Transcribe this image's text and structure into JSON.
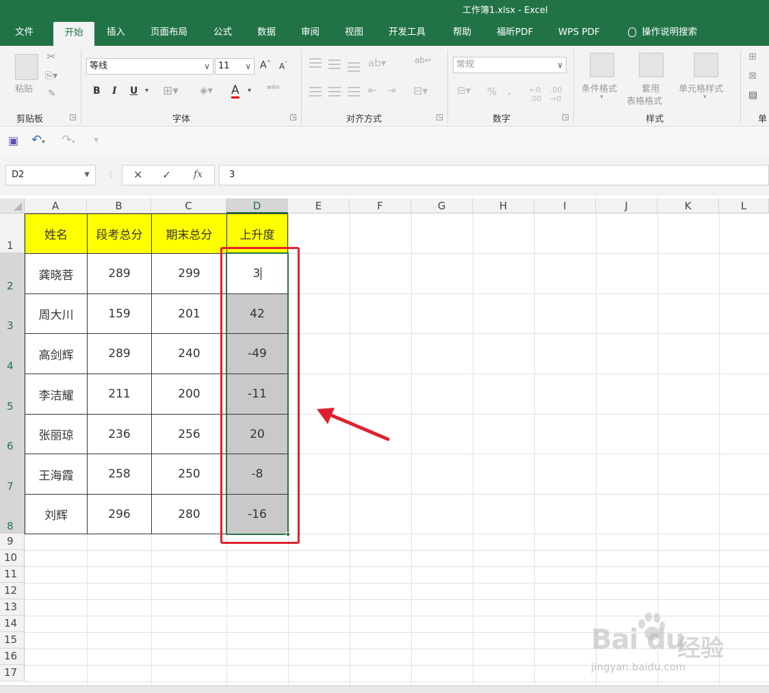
{
  "window": {
    "title": "工作簿1.xlsx  -  Excel"
  },
  "ribbon_tabs": [
    {
      "label": "文件",
      "active": false
    },
    {
      "label": "开始",
      "active": true
    },
    {
      "label": "插入",
      "active": false
    },
    {
      "label": "页面布局",
      "active": false
    },
    {
      "label": "公式",
      "active": false
    },
    {
      "label": "数据",
      "active": false
    },
    {
      "label": "审阅",
      "active": false
    },
    {
      "label": "视图",
      "active": false
    },
    {
      "label": "开发工具",
      "active": false
    },
    {
      "label": "帮助",
      "active": false
    },
    {
      "label": "福昕PDF",
      "active": false
    },
    {
      "label": "WPS PDF",
      "active": false
    },
    {
      "label": "操作说明搜索",
      "active": false
    }
  ],
  "ribbon": {
    "clipboard": {
      "label": "剪贴板",
      "paste": "粘贴"
    },
    "font": {
      "label": "字体",
      "font_name": "等线",
      "font_size": "11",
      "bold": "B",
      "italic": "I",
      "underline": "U",
      "font_color_glyph": "A",
      "grow": "A",
      "shrink": "A",
      "phonetic": "wén"
    },
    "alignment": {
      "label": "对齐方式"
    },
    "number": {
      "label": "数字",
      "format": "常规",
      "percent": "%",
      "comma": ","
    },
    "styles": {
      "label": "样式",
      "conditional": "条件格式",
      "table_style_1": "套用",
      "table_style_2": "表格格式",
      "cell_style": "单元格样式"
    },
    "cells": {
      "label": "单"
    }
  },
  "formula_bar": {
    "name_box": "D2",
    "fx": "fx",
    "value": "3"
  },
  "columns": [
    "A",
    "B",
    "C",
    "D",
    "E",
    "F",
    "G",
    "H",
    "I",
    "J",
    "K",
    "L"
  ],
  "rows": [
    "1",
    "2",
    "3",
    "4",
    "5",
    "6",
    "7",
    "8",
    "9",
    "10",
    "11",
    "12",
    "13",
    "14",
    "15",
    "16",
    "17"
  ],
  "table": {
    "headers": [
      "姓名",
      "段考总分",
      "期末总分",
      "上升度"
    ],
    "rows": [
      [
        "龚晓菩",
        "289",
        "299",
        "3"
      ],
      [
        "周大川",
        "159",
        "201",
        "42"
      ],
      [
        "高剑辉",
        "289",
        "240",
        "-49"
      ],
      [
        "李洁耀",
        "211",
        "200",
        "-11"
      ],
      [
        "张丽琼",
        "236",
        "256",
        "20"
      ],
      [
        "王海霞",
        "258",
        "250",
        "-8"
      ],
      [
        "刘辉",
        "296",
        "280",
        "-16"
      ]
    ]
  },
  "selection": {
    "active_cell": "D2",
    "range": "D2:D8"
  },
  "annotation": {
    "color": "#e0202e"
  },
  "watermark": {
    "logo": "Bai du",
    "brand": "经验",
    "url": "jingyan.baidu.com"
  },
  "colors": {
    "excel_green": "#217346",
    "header_yellow": "#ffff00",
    "selection_gray": "#c9c9c9"
  }
}
